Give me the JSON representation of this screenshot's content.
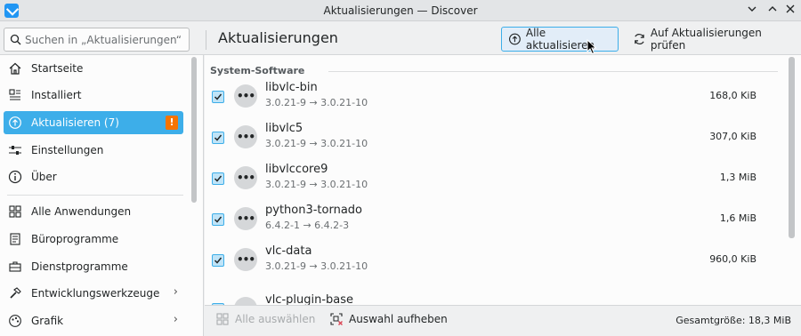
{
  "window": {
    "title": "Aktualisierungen — Discover"
  },
  "search": {
    "placeholder": "Suchen in „Aktualisierungen“ ..."
  },
  "header": {
    "title": "Aktualisierungen",
    "update_all_label": "Alle aktualisieren",
    "check_updates_label": "Auf Aktualisierungen prüfen"
  },
  "sidebar": {
    "items": [
      {
        "label": "Startseite",
        "icon": "home-icon"
      },
      {
        "label": "Installiert",
        "icon": "installed-list-icon"
      },
      {
        "label": "Aktualisieren (7)",
        "icon": "update-icon",
        "badge": "!"
      },
      {
        "label": "Einstellungen",
        "icon": "settings-sliders-icon"
      },
      {
        "label": "Über",
        "icon": "info-icon"
      },
      {
        "label": "Alle Anwendungen",
        "icon": "grid-icon"
      },
      {
        "label": "Büroprogramme",
        "icon": "office-icon"
      },
      {
        "label": "Dienstprogramme",
        "icon": "toolbox-icon"
      },
      {
        "label": "Entwicklungswerkzeuge",
        "icon": "hammer-icon",
        "chevron": "›"
      },
      {
        "label": "Grafik",
        "icon": "graphics-icon",
        "chevron": "›"
      }
    ]
  },
  "main": {
    "section": "System-Software",
    "updates": [
      {
        "name": "libvlc-bin",
        "version": "3.0.21-9 → 3.0.21-10",
        "size": "168,0 KiB",
        "checked": true
      },
      {
        "name": "libvlc5",
        "version": "3.0.21-9 → 3.0.21-10",
        "size": "307,0 KiB",
        "checked": true
      },
      {
        "name": "libvlccore9",
        "version": "3.0.21-9 → 3.0.21-10",
        "size": "1,3 MiB",
        "checked": true
      },
      {
        "name": "python3-tornado",
        "version": "6.4.2-1 → 6.4.2-3",
        "size": "1,6 MiB",
        "checked": true
      },
      {
        "name": "vlc-data",
        "version": "3.0.21-9 → 3.0.21-10",
        "size": "960,0 KiB",
        "checked": true
      },
      {
        "name": "vlc-plugin-base",
        "version": "",
        "size": "",
        "checked": true
      }
    ]
  },
  "footer": {
    "select_all_label": "Alle auswählen",
    "deselect_label": "Auswahl aufheben",
    "total_size": "Gesamtgröße: 18,3 MiB"
  },
  "colors": {
    "accent": "#3daee9",
    "badge": "#f67400"
  }
}
